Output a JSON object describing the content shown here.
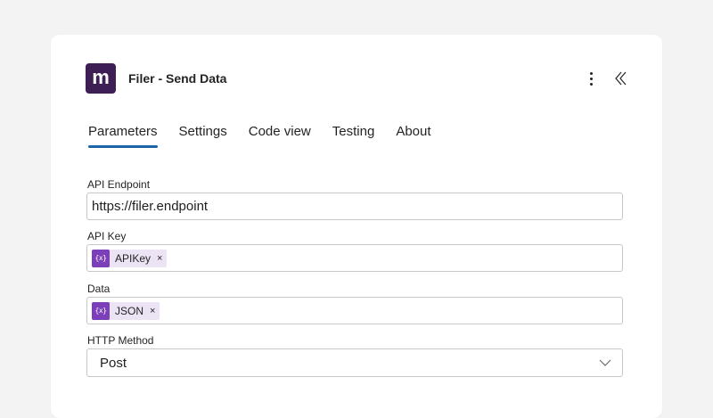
{
  "header": {
    "logo_letter": "m",
    "title": "Filer - Send Data"
  },
  "tabs": [
    {
      "label": "Parameters",
      "active": true
    },
    {
      "label": "Settings",
      "active": false
    },
    {
      "label": "Code view",
      "active": false
    },
    {
      "label": "Testing",
      "active": false
    },
    {
      "label": "About",
      "active": false
    }
  ],
  "fields": {
    "api_endpoint": {
      "label": "API Endpoint",
      "value": "https://filer.endpoint"
    },
    "api_key": {
      "label": "API Key",
      "token": {
        "icon": "{x}",
        "label": "APIKey",
        "remove": "×"
      }
    },
    "data": {
      "label": "Data",
      "token": {
        "icon": "{x}",
        "label": "JSON",
        "remove": "×"
      }
    },
    "http_method": {
      "label": "HTTP Method",
      "value": "Post"
    }
  },
  "icons": {
    "more": "more-vertical-icon",
    "collapse": "double-chevron-left-icon",
    "variable": "variable-icon",
    "dropdown": "chevron-down-icon"
  },
  "colors": {
    "logo_bg": "#3d1f55",
    "tab_underline": "#1a64a8",
    "token_icon_bg": "#7b3fb9",
    "token_bg": "#ece3f4",
    "page_bg": "#f3f3f3"
  }
}
